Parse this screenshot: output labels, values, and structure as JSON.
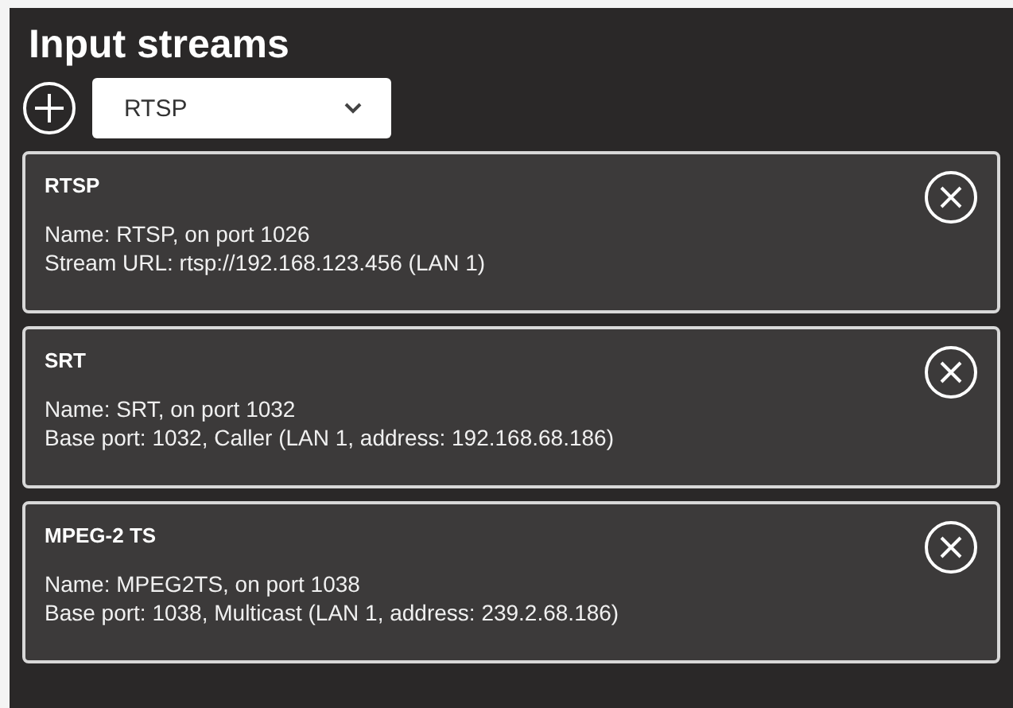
{
  "title": "Input streams",
  "selector": {
    "value": "RTSP"
  },
  "streams": [
    {
      "title": "RTSP",
      "lines": [
        "Name: RTSP, on port 1026",
        "Stream URL: rtsp://192.168.123.456 (LAN 1)"
      ]
    },
    {
      "title": "SRT",
      "lines": [
        "Name: SRT, on port 1032",
        "Base port: 1032, Caller (LAN 1, address: 192.168.68.186)"
      ]
    },
    {
      "title": "MPEG-2 TS",
      "lines": [
        "Name: MPEG2TS, on port 1038",
        "Base port: 1038, Multicast (LAN 1, address: 239.2.68.186)"
      ]
    }
  ]
}
